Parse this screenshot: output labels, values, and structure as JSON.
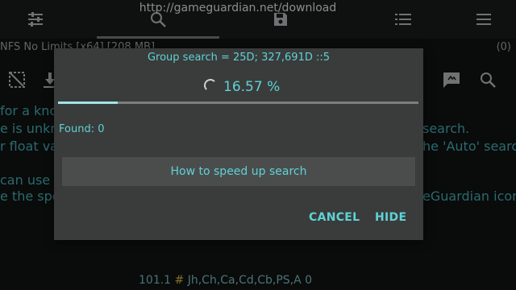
{
  "top_bar": {
    "url": "http://gameguardian.net/download",
    "tabs": [
      {
        "icon": "tune-icon"
      },
      {
        "icon": "search-icon"
      },
      {
        "icon": "save-icon"
      },
      {
        "icon": "list-icon"
      },
      {
        "icon": "menu-icon"
      }
    ]
  },
  "process": {
    "name": "NFS No Limits [x64] [208 MB]",
    "count": "(0)"
  },
  "toolbar_icons": [
    "selection-icon",
    "download-icon",
    "chat-icon",
    "search-icon"
  ],
  "background_text": {
    "lines": [
      "for a kno",
      "e is unkn",
      "r float va",
      "can use a",
      "e the spe"
    ],
    "right_lines": [
      "search.",
      "he 'Auto' search",
      "eGuardian icon"
    ]
  },
  "bottom_line": {
    "value": "101.1",
    "hash": "#",
    "types": "Jh,Ch,Ca,Cd,Cb,PS,A 0"
  },
  "dialog": {
    "title": "Group search = 25D; 327,691D ::5",
    "progress_text": "16.57 %",
    "progress_value": 0.1657,
    "found": "Found: 0",
    "help_button": "How to speed up search",
    "cancel": "CANCEL",
    "hide": "HIDE"
  },
  "colors": {
    "accent": "#5fd2d6",
    "dialog_bg": "#3a3b3b",
    "background": "#121313"
  }
}
